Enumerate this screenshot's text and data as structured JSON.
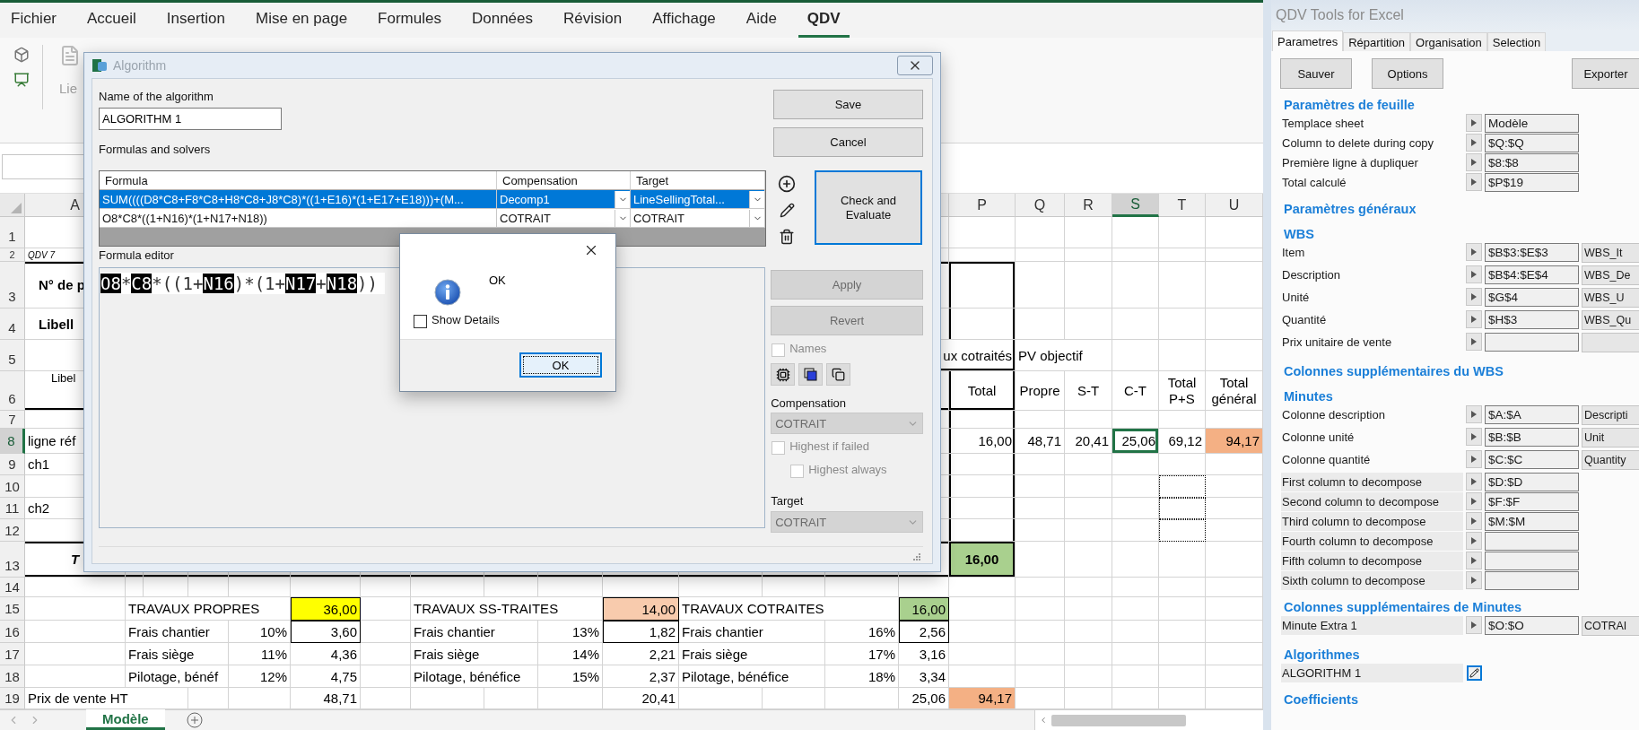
{
  "ribbon": {
    "tabs": [
      {
        "label": "Fichier",
        "selected": false
      },
      {
        "label": "Accueil",
        "selected": false
      },
      {
        "label": "Insertion",
        "selected": false
      },
      {
        "label": "Mise en page",
        "selected": false
      },
      {
        "label": "Formules",
        "selected": false
      },
      {
        "label": "Données",
        "selected": false
      },
      {
        "label": "Révision",
        "selected": false
      },
      {
        "label": "Affichage",
        "selected": false
      },
      {
        "label": "Aide",
        "selected": false
      },
      {
        "label": "QDV",
        "selected": true
      }
    ],
    "buttons": [
      {
        "label": "Lie"
      }
    ]
  },
  "sheet": {
    "column_headers": {
      "A": {
        "label": "A",
        "selected": false
      },
      "P": {
        "label": "P",
        "selected": false
      },
      "Q": {
        "label": "Q",
        "selected": false
      },
      "R": {
        "label": "R",
        "selected": false
      },
      "S": {
        "label": "S",
        "selected": true
      },
      "T": {
        "label": "T",
        "selected": false
      },
      "U": {
        "label": "U",
        "selected": false
      }
    },
    "rows": [
      {
        "header": "1",
        "selected": false
      },
      {
        "header": "2",
        "selected": false,
        "cells": {
          "A": {
            "text": "QDV 7",
            "kind": "note",
            "selected": false
          }
        }
      },
      {
        "header": "3",
        "selected": false,
        "cells": {
          "A": {
            "text": "N° de p",
            "kind": "left-bold",
            "selected": false
          }
        }
      },
      {
        "header": "4",
        "selected": false,
        "cells": {
          "A": {
            "text": "Libell",
            "kind": "left-bold",
            "selected": false
          }
        }
      },
      {
        "header": "5",
        "selected": false,
        "cells": {
          "P": {
            "text": "ux cotraités",
            "kind": "right-wide",
            "selected": false
          },
          "Q": {
            "text": "PV objectif",
            "kind": "left",
            "selected": false
          }
        }
      },
      {
        "header": "6",
        "selected": false,
        "cells": {
          "A": {
            "text": "Libel",
            "kind": "small",
            "selected": false
          },
          "P": {
            "text": "Total",
            "kind": "center",
            "selected": false
          },
          "Q": {
            "text": "Propre",
            "kind": "center",
            "selected": false
          },
          "R": {
            "text": "S-T",
            "kind": "center",
            "selected": false
          },
          "S": {
            "text": "C-T",
            "kind": "center",
            "selected": false
          },
          "T": {
            "text": "Total P+S",
            "kind": "center",
            "selected": false
          },
          "U": {
            "text": "Total général",
            "kind": "center",
            "selected": false
          }
        }
      },
      {
        "header": "7",
        "selected": false
      },
      {
        "header": "8",
        "selected": true,
        "cells": {
          "A": {
            "text": "ligne réf",
            "kind": "left",
            "selected": false
          },
          "P": {
            "text": "16,00",
            "kind": "right",
            "selected": false
          },
          "Q": {
            "text": "48,71",
            "kind": "right",
            "selected": false
          },
          "R": {
            "text": "20,41",
            "kind": "right",
            "selected": false
          },
          "S": {
            "text": "25,06",
            "kind": "right",
            "selected": true
          },
          "T": {
            "text": "69,12",
            "kind": "right",
            "selected": false
          },
          "U": {
            "text": "94,17",
            "kind": "right",
            "selected": false,
            "color": "#f4b084"
          }
        }
      },
      {
        "header": "9",
        "selected": false,
        "cells": {
          "A": {
            "text": "ch1",
            "kind": "left",
            "selected": false
          }
        }
      },
      {
        "header": "10",
        "selected": false
      },
      {
        "header": "11",
        "selected": false,
        "cells": {
          "A": {
            "text": "ch2",
            "kind": "left",
            "selected": false
          }
        }
      },
      {
        "header": "12",
        "selected": false
      },
      {
        "header": "13",
        "selected": false,
        "cells": {
          "A": {
            "text": "T",
            "kind": "center-italic",
            "selected": false
          },
          "P": {
            "text": "16,00",
            "kind": "center-bold",
            "selected": false,
            "color": "#a9d08e"
          }
        }
      },
      {
        "header": "14",
        "selected": false
      },
      {
        "header": "15",
        "selected": false,
        "cells": {
          "B": {
            "text": "TRAVAUX PROPRES",
            "kind": "left",
            "selected": false
          },
          "F": {
            "text": "36,00",
            "kind": "right",
            "selected": false,
            "color": "#ffff00"
          },
          "H": {
            "text": "TRAVAUX SS-TRAITES",
            "kind": "left",
            "selected": false
          },
          "K": {
            "text": "14,00",
            "kind": "right",
            "selected": false,
            "color": "#f8cbad"
          },
          "L": {
            "text": "TRAVAUX COTRAITES",
            "kind": "left",
            "selected": false
          },
          "O": {
            "text": "16,00",
            "kind": "right",
            "selected": false,
            "color": "#a9d08e"
          }
        }
      },
      {
        "header": "16",
        "selected": false,
        "cells": {
          "B": {
            "text": "Frais chantier",
            "kind": "left",
            "selected": false
          },
          "E": {
            "text": "10%",
            "kind": "right",
            "selected": false
          },
          "F": {
            "text": "3,60",
            "kind": "right",
            "selected": false
          },
          "H": {
            "text": "Frais chantier",
            "kind": "left",
            "selected": false
          },
          "J": {
            "text": "13%",
            "kind": "right",
            "selected": false
          },
          "K": {
            "text": "1,82",
            "kind": "right",
            "selected": false
          },
          "L": {
            "text": "Frais chantier",
            "kind": "left",
            "selected": false
          },
          "N": {
            "text": "16%",
            "kind": "right",
            "selected": false
          },
          "O": {
            "text": "2,56",
            "kind": "right",
            "selected": false
          }
        }
      },
      {
        "header": "17",
        "selected": false,
        "cells": {
          "B": {
            "text": "Frais siège",
            "kind": "left",
            "selected": false
          },
          "E": {
            "text": "11%",
            "kind": "right",
            "selected": false
          },
          "F": {
            "text": "4,36",
            "kind": "right",
            "selected": false
          },
          "H": {
            "text": "Frais siège",
            "kind": "left",
            "selected": false
          },
          "J": {
            "text": "14%",
            "kind": "right",
            "selected": false
          },
          "K": {
            "text": "2,21",
            "kind": "right",
            "selected": false
          },
          "L": {
            "text": "Frais siège",
            "kind": "left",
            "selected": false
          },
          "N": {
            "text": "17%",
            "kind": "right",
            "selected": false
          },
          "O": {
            "text": "3,16",
            "kind": "right",
            "selected": false
          }
        }
      },
      {
        "header": "18",
        "selected": false,
        "cells": {
          "B": {
            "text": "Pilotage, bénéf",
            "kind": "left",
            "selected": false
          },
          "E": {
            "text": "12%",
            "kind": "right",
            "selected": false
          },
          "F": {
            "text": "4,75",
            "kind": "right",
            "selected": false
          },
          "H": {
            "text": "Pilotage, bénéfice",
            "kind": "left",
            "selected": false
          },
          "J": {
            "text": "15%",
            "kind": "right",
            "selected": false
          },
          "K": {
            "text": "2,37",
            "kind": "right",
            "selected": false
          },
          "L": {
            "text": "Pilotage, bénéfice",
            "kind": "left",
            "selected": false
          },
          "N": {
            "text": "18%",
            "kind": "right",
            "selected": false
          },
          "O": {
            "text": "3,34",
            "kind": "right",
            "selected": false
          }
        }
      },
      {
        "header": "19",
        "selected": false,
        "cells": {
          "A": {
            "text": "Prix de vente HT",
            "kind": "left",
            "selected": false
          },
          "F": {
            "text": "48,71",
            "kind": "right",
            "selected": false
          },
          "K": {
            "text": "20,41",
            "kind": "right",
            "selected": false
          },
          "O": {
            "text": "25,06",
            "kind": "right",
            "selected": false
          },
          "P": {
            "text": "94,17",
            "kind": "right",
            "selected": false,
            "color": "#f4b084"
          }
        }
      }
    ]
  },
  "sheet_tabs": [
    {
      "label": "Modèle",
      "selected": true
    }
  ],
  "algorithm_dialog": {
    "title": "Algorithm",
    "name_label": "Name of the algorithm",
    "name_value": "ALGORITHM 1",
    "save": {
      "label": "Save",
      "disabled": false
    },
    "cancel": {
      "label": "Cancel",
      "disabled": false
    },
    "formulas_label": "Formulas and solvers",
    "formulas": {
      "columns": [
        "Formula",
        "Compensation",
        "Target"
      ],
      "rows": [
        {
          "formula": "SUM((((D8*C8+F8*C8+H8*C8+J8*C8)*((1+E16)*(1+E17+E18)))+(M...",
          "compensation": "Decomp1",
          "target": "LineSellingTotal...",
          "selected": true
        },
        {
          "formula": "O8*C8*((1+N16)*(1+N17+N18))",
          "compensation": "COTRAIT",
          "target": "COTRAIT",
          "selected": false
        }
      ]
    },
    "check_button": "Check and Evaluate",
    "editor_label": "Formula editor",
    "editor_tokens": [
      {
        "text": "O8",
        "kind": "ref"
      },
      {
        "text": "*",
        "kind": "op"
      },
      {
        "text": "C8",
        "kind": "ref"
      },
      {
        "text": "*((1+",
        "kind": "op"
      },
      {
        "text": "N16",
        "kind": "ref"
      },
      {
        "text": ")*(1+",
        "kind": "op"
      },
      {
        "text": "N17",
        "kind": "ref"
      },
      {
        "text": "+",
        "kind": "op"
      },
      {
        "text": "N18",
        "kind": "ref"
      },
      {
        "text": "))",
        "kind": "op"
      }
    ],
    "apply": {
      "label": "Apply",
      "disabled": true
    },
    "revert": {
      "label": "Revert",
      "disabled": true
    },
    "names": {
      "label": "Names",
      "checked": false,
      "disabled": true
    },
    "compensation_label": "Compensation",
    "compensation": {
      "value": "COTRAIT",
      "disabled": true
    },
    "highest_if_failed": {
      "label": "Highest if failed",
      "checked": false,
      "disabled": true
    },
    "highest_always": {
      "label": "Highest always",
      "checked": false,
      "disabled": true
    },
    "target_label": "Target",
    "target": {
      "value": "COTRAIT",
      "disabled": true
    }
  },
  "message_box": {
    "message": "OK",
    "show_details": {
      "label": "Show Details",
      "checked": false
    },
    "ok_button": "OK"
  },
  "task_pane": {
    "title": "QDV Tools for Excel",
    "tabs": [
      {
        "label": "Parametres",
        "selected": true
      },
      {
        "label": "Répartition",
        "selected": false
      },
      {
        "label": "Organisation",
        "selected": false
      },
      {
        "label": "Selection",
        "selected": false
      }
    ],
    "buttons": [
      "Sauver",
      "Options",
      "Exporter"
    ],
    "sections": [
      {
        "title": "Paramètres de feuille",
        "rows": [
          {
            "label": "Templace sheet",
            "kind": "plain",
            "fields": [
              {
                "kind": "range",
                "value": "Modèle"
              }
            ]
          },
          {
            "label": "Column to delete during copy",
            "kind": "plain",
            "fields": [
              {
                "kind": "range",
                "value": "$Q:$Q"
              }
            ]
          },
          {
            "label": "Première ligne à dupliquer",
            "kind": "plain",
            "fields": [
              {
                "kind": "range",
                "value": "$8:$8"
              }
            ]
          },
          {
            "label": "Total calculé",
            "kind": "plain",
            "fields": [
              {
                "kind": "range",
                "value": "$P$19"
              }
            ]
          }
        ]
      },
      {
        "title": "Paramètres généraux"
      },
      {
        "title": "WBS",
        "rows": [
          {
            "label": "Item",
            "kind": "plain",
            "fields": [
              {
                "kind": "range",
                "value": "$B$3:$E$3"
              },
              {
                "kind": "name",
                "value": "WBS_It"
              }
            ]
          },
          {
            "label": "Description",
            "kind": "plain",
            "fields": [
              {
                "kind": "range",
                "value": "$B$4:$E$4"
              },
              {
                "kind": "name",
                "value": "WBS_De"
              }
            ]
          },
          {
            "label": "Unité",
            "kind": "plain",
            "fields": [
              {
                "kind": "range",
                "value": "$G$4"
              },
              {
                "kind": "name",
                "value": "WBS_U"
              }
            ]
          },
          {
            "label": "Quantité",
            "kind": "plain",
            "fields": [
              {
                "kind": "range",
                "value": "$H$3"
              },
              {
                "kind": "name",
                "value": "WBS_Qu"
              }
            ]
          },
          {
            "label": "Prix unitaire de vente",
            "kind": "plain",
            "fields": [
              {
                "kind": "range"
              },
              {
                "kind": "name"
              }
            ]
          }
        ]
      },
      {
        "title": "Colonnes supplémentaires du WBS"
      },
      {
        "title": "Minutes",
        "rows": [
          {
            "label": "Colonne description",
            "kind": "plain",
            "fields": [
              {
                "kind": "range",
                "value": "$A:$A"
              },
              {
                "kind": "name",
                "value": "Descripti"
              }
            ]
          },
          {
            "label": "Colonne unité",
            "kind": "plain",
            "fields": [
              {
                "kind": "range",
                "value": "$B:$B"
              },
              {
                "kind": "name",
                "value": "Unit"
              }
            ]
          },
          {
            "label": "Colonne quantité",
            "kind": "plain",
            "fields": [
              {
                "kind": "range",
                "value": "$C:$C"
              },
              {
                "kind": "name",
                "value": "Quantity"
              }
            ]
          },
          {
            "label": "First column to decompose",
            "kind": "shaded",
            "fields": [
              {
                "kind": "range",
                "value": "$D:$D"
              }
            ]
          },
          {
            "label": "Second column to decompose",
            "kind": "shaded",
            "fields": [
              {
                "kind": "range",
                "value": "$F:$F"
              }
            ]
          },
          {
            "label": "Third column to decompose",
            "kind": "shaded",
            "fields": [
              {
                "kind": "range",
                "value": "$M:$M"
              }
            ]
          },
          {
            "label": "Fourth column to decompose",
            "kind": "shaded",
            "fields": [
              {
                "kind": "range"
              }
            ]
          },
          {
            "label": "Fifth column to decompose",
            "kind": "shaded",
            "fields": [
              {
                "kind": "range"
              }
            ]
          },
          {
            "label": "Sixth column to decompose",
            "kind": "shaded",
            "fields": [
              {
                "kind": "range"
              }
            ]
          }
        ]
      },
      {
        "title": "Colonnes supplémentaires de Minutes",
        "rows": [
          {
            "label": "Minute Extra 1",
            "kind": "shaded",
            "fields": [
              {
                "kind": "range",
                "value": "$O:$O"
              },
              {
                "kind": "name",
                "value": "COTRAI"
              }
            ]
          }
        ]
      },
      {
        "title": "Algorithmes",
        "rows": [
          {
            "label": "ALGORITHM 1",
            "kind": "algorithm"
          }
        ]
      },
      {
        "title": "Coefficients"
      }
    ]
  }
}
